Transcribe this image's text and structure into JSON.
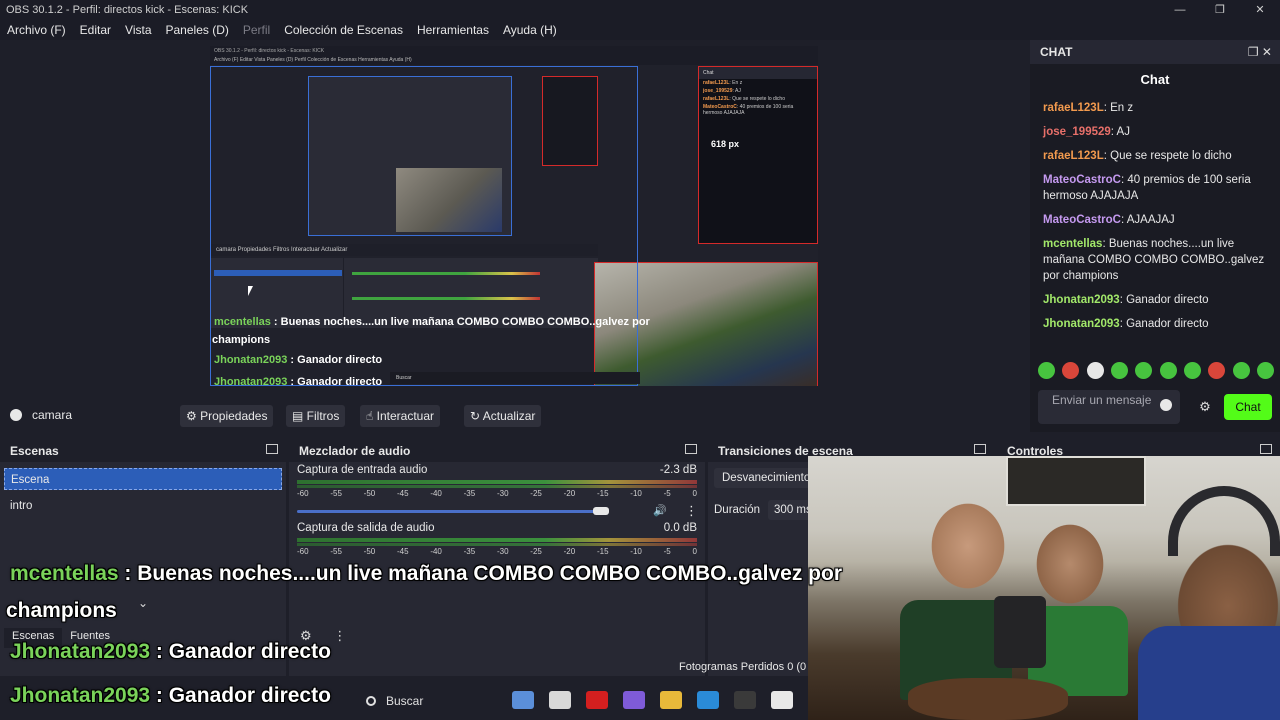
{
  "window": {
    "title": "OBS 30.1.2 - Perfil: directos kick - Escenas: KICK",
    "min": "—",
    "max": "❐",
    "close": "✕"
  },
  "menu": [
    {
      "label": "Archivo (F)",
      "dim": false
    },
    {
      "label": "Editar",
      "dim": false
    },
    {
      "label": "Vista",
      "dim": false
    },
    {
      "label": "Paneles (D)",
      "dim": false
    },
    {
      "label": "Perfil",
      "dim": true
    },
    {
      "label": "Colección de Escenas",
      "dim": false
    },
    {
      "label": "Herramientas",
      "dim": false
    },
    {
      "label": "Ayuda (H)",
      "dim": false
    }
  ],
  "nested": {
    "title": "OBS 30.1.2 - Perfil: directos kick - Escenas: KICK",
    "menu": "Archivo (F)   Editar   Vista   Paneles (D)   Perfil   Colección de Escenas   Herramientas   Ayuda (H)",
    "chat_head": "Chat",
    "px_label": "618 px",
    "chat_lines": [
      {
        "u": "rafaeL123L",
        "t": ": En z"
      },
      {
        "u": "jose_199529",
        "t": ": AJ"
      },
      {
        "u": "rafaeL123L",
        "t": ": Que se respete lo dicho"
      },
      {
        "u": "MateoCastroC",
        "t": ": 40 premios de 100 seria hermoso AJAJAJA"
      }
    ],
    "toolbar": "camara        Propiedades    Filtros    Interactuar    Actualizar",
    "overlay1_name": "mcentellas",
    "overlay1_text": " : Buenas noches....un live mañana COMBO COMBO COMBO..galvez por",
    "overlay2": "champions",
    "overlay3_name": "Jhonatan2093",
    "overlay3_text": " : Ganador directo",
    "overlay4_name": "Jhonatan2093",
    "overlay4_text": " : Ganador directo",
    "taskbar_search": "Buscar"
  },
  "chat": {
    "dock_title": "CHAT",
    "title": "Chat",
    "messages": [
      {
        "user": "rafaeL123L",
        "text": ": En z",
        "color": "#f29a4e"
      },
      {
        "user": "jose_199529",
        "text": ": AJ",
        "color": "#e8706a"
      },
      {
        "user": "rafaeL123L",
        "text": ": Que se respete lo dicho",
        "color": "#f29a4e"
      },
      {
        "user": "MateoCastroC",
        "text": ": 40 premios de 100 seria hermoso AJAJAJA",
        "color": "#c59af0"
      },
      {
        "user": "MateoCastroC",
        "text": ": AJAAJAJ",
        "color": "#c59af0"
      },
      {
        "user": "mcentellas",
        "text": ": Buenas noches....un live mañana COMBO COMBO COMBO..galvez por champions",
        "color": "#a2e86a"
      },
      {
        "user": "Jhonatan2093",
        "text": ": Ganador directo",
        "color": "#a2e86a"
      },
      {
        "user": "Jhonatan2093",
        "text": ": Ganador directo",
        "color": "#a2e86a"
      }
    ],
    "input_placeholder": "Enviar un mensaje",
    "send": "Chat",
    "accent": "#53fc18"
  },
  "source_toolbar": {
    "source": "camara",
    "properties": "Propiedades",
    "filters": "Filtros",
    "interact": "Interactuar",
    "refresh": "Actualizar"
  },
  "scenes": {
    "title": "Escenas",
    "items": [
      "Escena",
      "intro"
    ],
    "tabs": [
      "Escenas",
      "Fuentes"
    ]
  },
  "mixer": {
    "title": "Mezclador de audio",
    "channels": [
      {
        "name": "Captura de entrada audio",
        "db": "-2.3 dB"
      },
      {
        "name": "Captura de salida de audio",
        "db": "0.0 dB"
      }
    ],
    "ticks": [
      "-60",
      "-55",
      "-50",
      "-45",
      "-40",
      "-35",
      "-30",
      "-25",
      "-20",
      "-15",
      "-10",
      "-5",
      "0"
    ],
    "volume_fraction": 0.9
  },
  "transitions": {
    "title": "Transiciones de escena",
    "type": "Desvanecimiento",
    "duration_label": "Duración",
    "duration": "300 ms"
  },
  "controls": {
    "title": "Controles"
  },
  "stats": "Fotogramas Perdidos 0 (0",
  "overlays": {
    "line1_name": "mcentellas",
    "line1_text": " : Buenas noches....un live mañana COMBO COMBO COMBO..galvez por",
    "line2": "champions",
    "line3_name": "Jhonatan2093",
    "line3_text": " : Ganador directo",
    "line4_name": "Jhonatan2093",
    "line4_text": " : Ganador directo"
  },
  "taskbar": {
    "search": "Buscar"
  }
}
